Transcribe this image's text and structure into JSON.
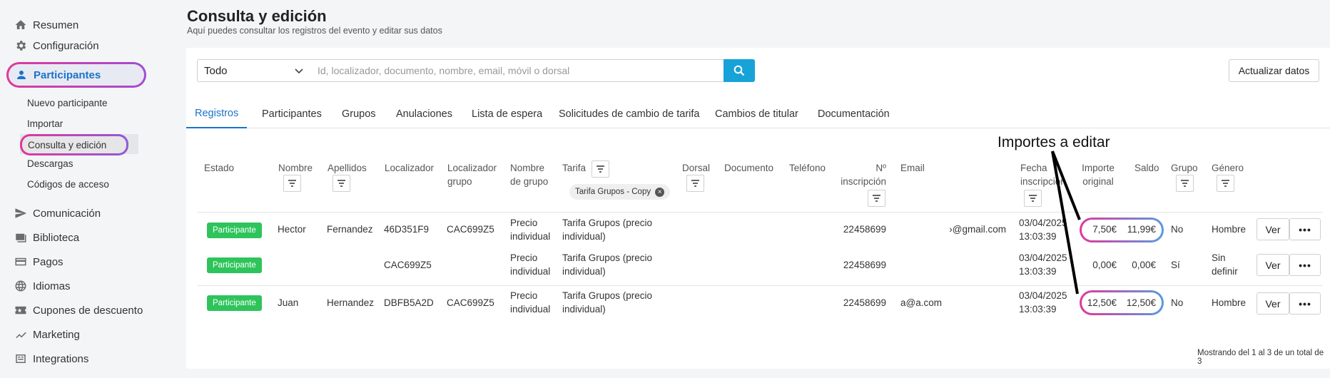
{
  "sidebar": {
    "items": [
      {
        "label": "Resumen",
        "icon": "home-icon"
      },
      {
        "label": "Configuración",
        "icon": "gear-icon"
      },
      {
        "label": "Participantes",
        "icon": "person-icon"
      },
      {
        "label": "Comunicación",
        "icon": "send-icon"
      },
      {
        "label": "Biblioteca",
        "icon": "images-icon"
      },
      {
        "label": "Pagos",
        "icon": "card-icon"
      },
      {
        "label": "Idiomas",
        "icon": "globe-icon"
      },
      {
        "label": "Cupones de descuento",
        "icon": "ticket-icon"
      },
      {
        "label": "Marketing",
        "icon": "trend-icon"
      },
      {
        "label": "Integrations",
        "icon": "integrations-icon"
      }
    ],
    "sub_items": [
      {
        "label": "Nuevo participante"
      },
      {
        "label": "Importar"
      },
      {
        "label": "Consulta y edición"
      },
      {
        "label": "Descargas"
      },
      {
        "label": "Códigos de acceso"
      }
    ]
  },
  "header": {
    "title": "Consulta y edición",
    "subtitle": "Aquí puedes consultar los registros del evento y editar sus datos"
  },
  "toolbar": {
    "filter_value": "Todo",
    "search_placeholder": "Id, localizador, documento, nombre, email, móvil o dorsal",
    "update_label": "Actualizar datos"
  },
  "tabs": [
    {
      "label": "Registros"
    },
    {
      "label": "Participantes"
    },
    {
      "label": "Grupos"
    },
    {
      "label": "Anulaciones"
    },
    {
      "label": "Lista de espera"
    },
    {
      "label": "Solicitudes de cambio de tarifa"
    },
    {
      "label": "Cambios de titular"
    },
    {
      "label": "Documentación"
    }
  ],
  "annotation": "Importes a editar",
  "table": {
    "columns": [
      {
        "l1": "Estado",
        "l2": "",
        "l3": ""
      },
      {
        "l1": "Nombre",
        "l2": "",
        "l3": ""
      },
      {
        "l1": "Apellidos",
        "l2": "",
        "l3": ""
      },
      {
        "l1": "Localizador",
        "l2": "",
        "l3": ""
      },
      {
        "l1": "Localizador",
        "l2": "grupo",
        "l3": ""
      },
      {
        "l1": "Nombre",
        "l2": "de grupo",
        "l3": ""
      },
      {
        "l1": "Tarifa",
        "l2": "",
        "l3": ""
      },
      {
        "l1": "Dorsal",
        "l2": "",
        "l3": ""
      },
      {
        "l1": "Documento",
        "l2": "",
        "l3": ""
      },
      {
        "l1": "Teléfono",
        "l2": "",
        "l3": ""
      },
      {
        "l1": "Nº",
        "l2": "inscripción",
        "l3": ""
      },
      {
        "l1": "Email",
        "l2": "",
        "l3": ""
      },
      {
        "l1": "Fecha",
        "l2": "inscripción",
        "l3": ""
      },
      {
        "l1": "Importe",
        "l2": "original",
        "l3": ""
      },
      {
        "l1": "Saldo",
        "l2": "",
        "l3": ""
      },
      {
        "l1": "Grupo",
        "l2": "",
        "l3": ""
      },
      {
        "l1": "Género",
        "l2": "",
        "l3": ""
      }
    ],
    "tarifa_chip": "Tarifa Grupos - Copy",
    "rows": [
      {
        "estado": "Participante",
        "nombre": "Hector",
        "apellidos": "Fernandez",
        "localizador": "46D351F9",
        "localizador_grupo": "CAC699Z5",
        "nombre_grupo_1": "Precio",
        "nombre_grupo_2": "individual",
        "tarifa_1": "Tarifa Grupos (precio",
        "tarifa_2": "individual)",
        "n_inscripcion": "22458699",
        "email": "›@gmail.com",
        "fecha_1": "03/04/2025",
        "fecha_2": "13:03:39",
        "importe": "7,50€",
        "saldo": "11,99€",
        "grupo": "No",
        "genero_1": "Hombre",
        "genero_2": "",
        "ver": "Ver",
        "more": "•••"
      },
      {
        "estado": "Participante",
        "nombre": "",
        "apellidos": "",
        "localizador": "CAC699Z5",
        "localizador_grupo": "",
        "nombre_grupo_1": "Precio",
        "nombre_grupo_2": "individual",
        "tarifa_1": "Tarifa Grupos (precio",
        "tarifa_2": "individual)",
        "n_inscripcion": "22458699",
        "email": "",
        "fecha_1": "03/04/2025",
        "fecha_2": "13:03:39",
        "importe": "0,00€",
        "saldo": "0,00€",
        "grupo": "Sí",
        "genero_1": "Sin",
        "genero_2": "definir",
        "ver": "Ver",
        "more": "•••"
      },
      {
        "estado": "Participante",
        "nombre": "Juan",
        "apellidos": "Hernandez",
        "localizador": "DBFB5A2D",
        "localizador_grupo": "CAC699Z5",
        "nombre_grupo_1": "Precio",
        "nombre_grupo_2": "individual",
        "tarifa_1": "Tarifa Grupos (precio",
        "tarifa_2": "individual)",
        "n_inscripcion": "22458699",
        "email": "a@a.com",
        "fecha_1": "03/04/2025",
        "fecha_2": "13:03:39",
        "importe": "12,50€",
        "saldo": "12,50€",
        "grupo": "No",
        "genero_1": "Hombre",
        "genero_2": "",
        "ver": "Ver",
        "more": "•••"
      }
    ]
  },
  "footer": "Mostrando del 1 al 3 de un total de 3",
  "colors": {
    "accent": "#1a73c9",
    "search_button": "#17a2d8",
    "badge": "#2ec45b",
    "highlight_start": "#e0389a",
    "highlight_end": "#5a9ae0"
  }
}
